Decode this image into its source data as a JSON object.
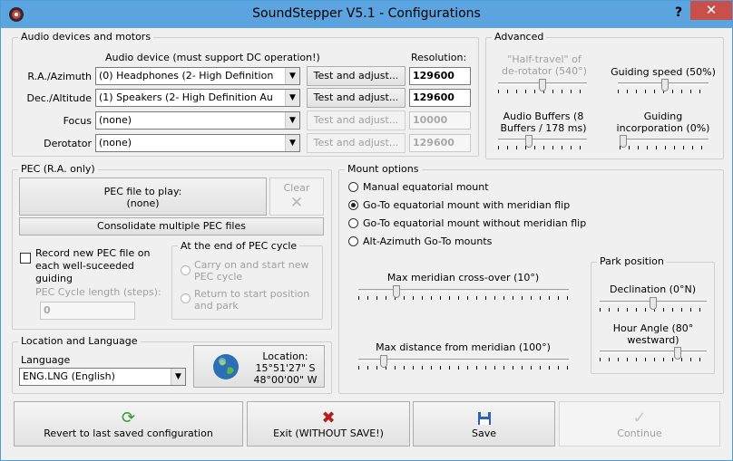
{
  "window": {
    "title": "SoundStepper V5.1 - Configurations",
    "help": "?",
    "close": "✕"
  },
  "audio": {
    "legend": "Audio devices and motors",
    "device_header": "Audio device (must support DC operation!)",
    "resolution_header": "Resolution:",
    "rows": [
      {
        "label": "R.A./Azimuth",
        "device": "(0) Headphones (2- High Definition",
        "button": "Test and adjust...",
        "resolution": "129600"
      },
      {
        "label": "Dec./Altitude",
        "device": "(1) Speakers (2- High Definition Au",
        "button": "Test and adjust...",
        "resolution": "129600"
      },
      {
        "label": "Focus",
        "device": "(none)",
        "button": "Test and adjust...",
        "resolution": "10000"
      },
      {
        "label": "Derotator",
        "device": "(none)",
        "button": "Test and adjust...",
        "resolution": "129600"
      }
    ]
  },
  "advanced": {
    "legend": "Advanced",
    "half_travel": "\"Half-travel\" of de-rotator (540°)",
    "guiding_speed": "Guiding speed (50%)",
    "audio_buffers": "Audio Buffers (8 Buffers / 178 ms)",
    "guiding_incorporation": "Guiding incorporation (0%)"
  },
  "pec": {
    "legend": "PEC (R.A. only)",
    "file_button_line1": "PEC file to play:",
    "file_button_line2": "(none)",
    "clear": "Clear",
    "consolidate": "Consolidate multiple PEC files",
    "record": "Record new PEC file on each well-suceeded guiding",
    "cycle_length_label": "PEC Cycle length (steps):",
    "cycle_length_value": "0",
    "end_cycle_legend": "At the end of PEC cycle",
    "carry_on": "Carry on and start new PEC cycle",
    "return_park": "Return to start position and park"
  },
  "mount": {
    "legend": "Mount options",
    "options": [
      "Manual equatorial mount",
      "Go-To equatorial mount with meridian flip",
      "Go-To equatorial mount without meridian flip",
      "Alt-Azimuth Go-To mounts"
    ],
    "max_crossover": "Max meridian cross-over (10°)",
    "max_distance": "Max distance from meridian (100°)",
    "park_legend": "Park position",
    "declination": "Declination (0°N)",
    "hour_angle": "Hour Angle (80° westward)"
  },
  "location": {
    "legend": "Location and Language",
    "language_label": "Language",
    "language_value": "ENG.LNG (English)",
    "loc_line1": "Location:",
    "loc_line2": "15°51'27\" S",
    "loc_line3": "48°00'00\" W"
  },
  "footer": {
    "revert": "Revert to last saved configuration",
    "exit": "Exit (WITHOUT SAVE!)",
    "save": "Save",
    "continue": "Continue"
  }
}
